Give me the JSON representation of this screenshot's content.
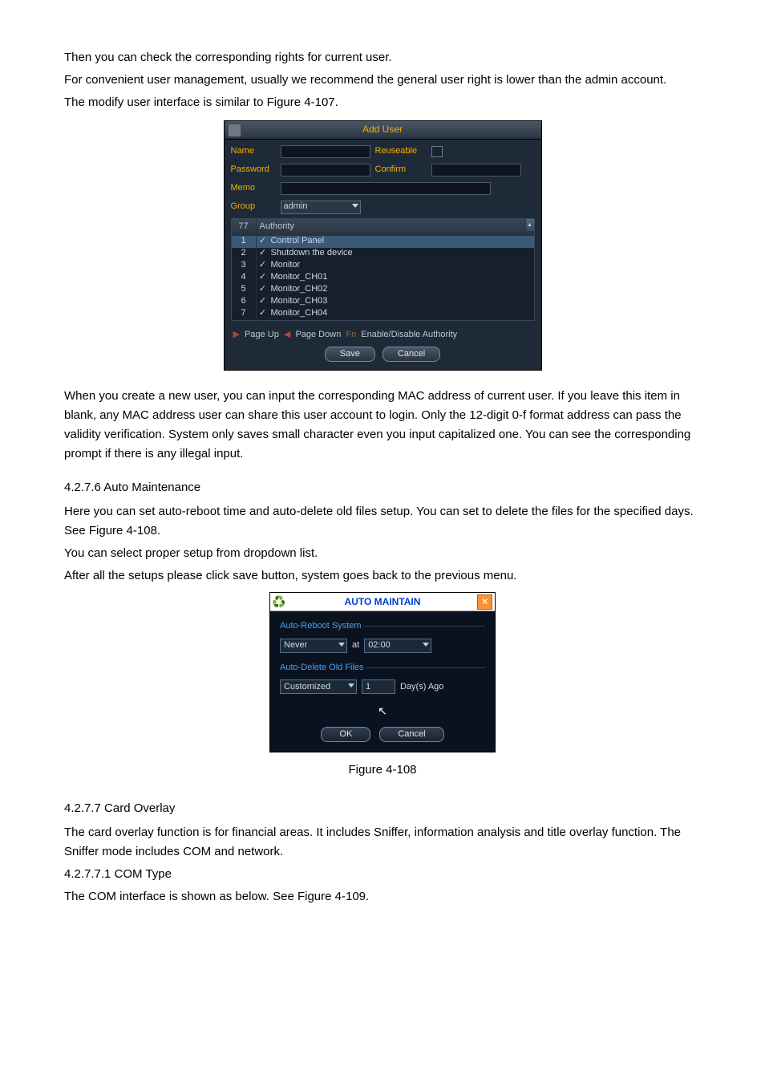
{
  "intro": {
    "p1": "Then you can check the corresponding rights for current user.",
    "p2": "For convenient user management, usually we recommend the general user right is lower than the admin account.",
    "p3": "The modify user interface is similar to Figure 4-107."
  },
  "addUser": {
    "title": "Add User",
    "labels": {
      "name": "Name",
      "password": "Password",
      "memo": "Memo",
      "group": "Group",
      "reuseable": "Reuseable",
      "confirm": "Confirm"
    },
    "groupValue": "admin",
    "table": {
      "headerCount": "77",
      "headerAuthority": "Authority",
      "rows": [
        {
          "n": "1",
          "label": "Control Panel"
        },
        {
          "n": "2",
          "label": "Shutdown the device"
        },
        {
          "n": "3",
          "label": "Monitor"
        },
        {
          "n": "4",
          "label": "Monitor_CH01"
        },
        {
          "n": "5",
          "label": "Monitor_CH02"
        },
        {
          "n": "6",
          "label": "Monitor_CH03"
        },
        {
          "n": "7",
          "label": "Monitor_CH04"
        }
      ]
    },
    "nav": {
      "pageUp": "Page Up",
      "pageDown": "Page Down",
      "fn": "Fn",
      "enable": "Enable/Disable Authority"
    },
    "buttons": {
      "save": "Save",
      "cancel": "Cancel"
    }
  },
  "midParagraph": "When you create a new user, you can input the corresponding MAC address of current user. If you leave this item in blank, any MAC address user can share this user account to login. Only the 12-digit 0-f format address can pass the validity verification. System only saves small character even you input capitalized one. You can see the corresponding prompt if there is any illegal input.",
  "section4276": {
    "title": "4.2.7.6  Auto Maintenance",
    "p1": "Here you can set auto-reboot time and auto-delete old files setup. You can set to delete the files for the specified days. See Figure 4-108.",
    "p2": "You can select proper setup from dropdown list.",
    "p3": "After all the setups please click save button, system goes back to the previous menu."
  },
  "autoMaint": {
    "title": "AUTO MAINTAIN",
    "sectionReboot": "Auto-Reboot System",
    "sectionDelete": "Auto-Delete Old Files",
    "rebootWhen": "Never",
    "at": "at",
    "time": "02:00",
    "deleteMode": "Customized",
    "days": "1",
    "daysAgo": "Day(s) Ago",
    "buttons": {
      "ok": "OK",
      "cancel": "Cancel"
    }
  },
  "figure108": "Figure 4-108",
  "section4277": {
    "title": "4.2.7.7  Card Overlay",
    "p1": "The card overlay function is for financial areas. It includes Sniffer, information analysis and title overlay function. The Sniffer mode includes COM and network.",
    "sub": "4.2.7.7.1    COM Type",
    "p2": "The COM interface is shown as below. See Figure 4-109."
  }
}
